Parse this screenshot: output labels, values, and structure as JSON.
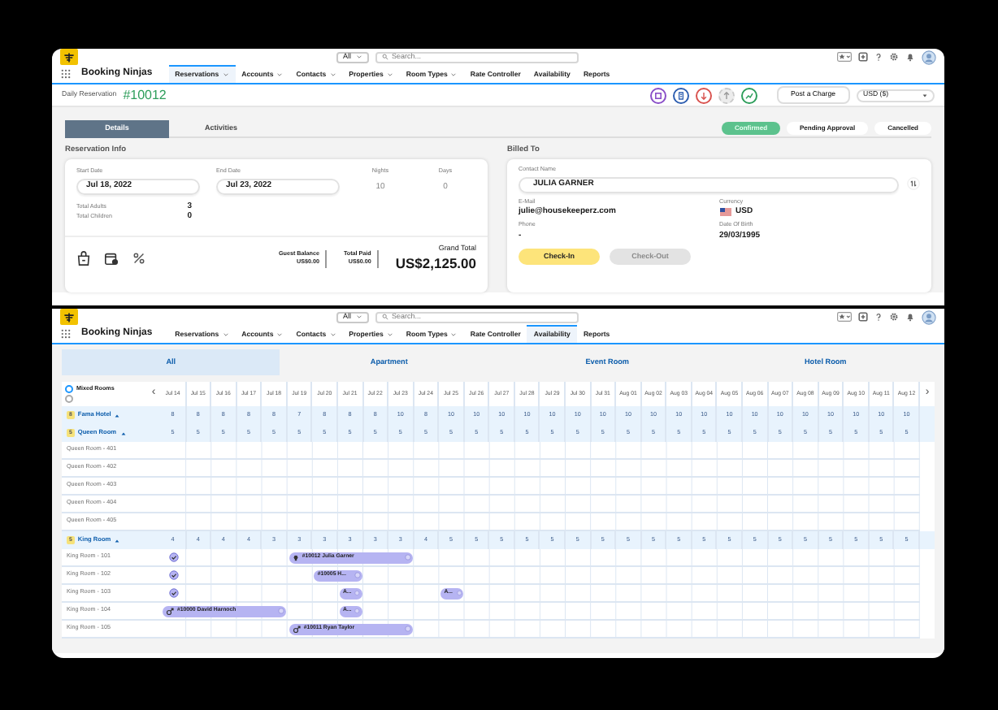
{
  "reservation_window": {
    "header": {
      "search_scope": "All",
      "search_placeholder": "Search..."
    },
    "app_name": "Booking Ninjas",
    "nav": [
      {
        "label": "Reservations",
        "has_menu": true,
        "selected": true
      },
      {
        "label": "Accounts",
        "has_menu": true,
        "selected": false
      },
      {
        "label": "Contacts",
        "has_menu": true,
        "selected": false
      },
      {
        "label": "Properties",
        "has_menu": true,
        "selected": false
      },
      {
        "label": "Room Types",
        "has_menu": true,
        "selected": false
      },
      {
        "label": "Rate Controller",
        "has_menu": false,
        "selected": false
      },
      {
        "label": "Availability",
        "has_menu": false,
        "selected": false
      },
      {
        "label": "Reports",
        "has_menu": false,
        "selected": false
      }
    ],
    "record": {
      "type_label": "Daily Reservation",
      "number": "#10012"
    },
    "action_buttons": [
      {
        "kind": "scan",
        "color": "#8a4fc8",
        "disabled": false
      },
      {
        "kind": "document",
        "color": "#2f5fb0",
        "disabled": false
      },
      {
        "kind": "download",
        "color": "#d9534f",
        "disabled": false
      },
      {
        "kind": "upload",
        "color": "#c9c9c9",
        "disabled": true
      },
      {
        "kind": "trend",
        "color": "#2e9e5b",
        "disabled": false
      }
    ],
    "post_charge": "Post a Charge",
    "currency_select": "USD ($)",
    "tabs": [
      {
        "label": "Details",
        "selected": true
      },
      {
        "label": "Activities",
        "selected": false
      }
    ],
    "statuses": [
      {
        "label": "Confirmed",
        "selected": true
      },
      {
        "label": "Pending Approval",
        "selected": false
      },
      {
        "label": "Cancelled",
        "selected": false
      }
    ],
    "reservation_info": {
      "title": "Reservation Info",
      "dates": [
        {
          "label": "Start Date",
          "value": "Jul 18, 2022"
        },
        {
          "label": "End Date",
          "value": "Jul 23, 2022"
        }
      ],
      "stays": [
        {
          "label": "Nights",
          "value": "10"
        },
        {
          "label": "Days",
          "value": "0"
        }
      ],
      "guests": [
        {
          "label": "Total Adults",
          "value": "3"
        },
        {
          "label": "Total Children",
          "value": "0"
        }
      ],
      "totals": [
        {
          "label": "Guest Balance",
          "value": "US$0.00"
        },
        {
          "label": "Total Paid",
          "value": "US$0.00"
        }
      ],
      "grand_total": {
        "label": "Grand Total",
        "value": "US$2,125.00"
      }
    },
    "billed_to": {
      "title": "Billed To",
      "contact": {
        "label": "Contact Name",
        "value": "JULIA GARNER"
      },
      "fields": [
        {
          "label": "E-Mail",
          "value": "julie@housekeeperz.com",
          "kind": "text"
        },
        {
          "label": "Currency",
          "value": "USD",
          "kind": "flag"
        },
        {
          "label": "Phone",
          "value": "-",
          "kind": "text"
        },
        {
          "label": "Date Of Birth",
          "value": "29/03/1995",
          "kind": "text"
        }
      ],
      "buttons": [
        {
          "label": "Check-In",
          "disabled": false
        },
        {
          "label": "Check-Out",
          "disabled": true
        }
      ]
    }
  },
  "availability_window": {
    "header": {
      "search_scope": "All",
      "search_placeholder": "Search..."
    },
    "app_name": "Booking Ninjas",
    "nav": [
      {
        "label": "Reservations",
        "has_menu": true,
        "selected": false
      },
      {
        "label": "Accounts",
        "has_menu": true,
        "selected": false
      },
      {
        "label": "Contacts",
        "has_menu": true,
        "selected": false
      },
      {
        "label": "Properties",
        "has_menu": true,
        "selected": false
      },
      {
        "label": "Room Types",
        "has_menu": true,
        "selected": false
      },
      {
        "label": "Rate Controller",
        "has_menu": false,
        "selected": false
      },
      {
        "label": "Availability",
        "has_menu": false,
        "selected": true
      },
      {
        "label": "Reports",
        "has_menu": false,
        "selected": false
      }
    ],
    "categories": [
      {
        "label": "All",
        "selected": true
      },
      {
        "label": "Apartment",
        "selected": false
      },
      {
        "label": "Event Room",
        "selected": false
      },
      {
        "label": "Hotel Room",
        "selected": false
      }
    ],
    "view_options": [
      {
        "label": "Mixed Rooms",
        "selected": true
      },
      {
        "selected": false
      }
    ],
    "prev": "‹",
    "next": "›",
    "dates": [
      "Jul 14",
      "Jul 15",
      "Jul 16",
      "Jul 17",
      "Jul 18",
      "Jul 19",
      "Jul 20",
      "Jul 21",
      "Jul 22",
      "Jul 23",
      "Jul 24",
      "Jul 25",
      "Jul 26",
      "Jul 27",
      "Jul 28",
      "Jul 29",
      "Jul 30",
      "Jul 31",
      "Aug 01",
      "Aug 02",
      "Aug 03",
      "Aug 04",
      "Aug 05",
      "Aug 06",
      "Aug 07",
      "Aug 08",
      "Aug 09",
      "Aug 10",
      "Aug 11",
      "Aug 12"
    ],
    "rows": [
      {
        "kind": "group",
        "badge": "8",
        "label": "Fama Hotel",
        "expanded": true,
        "counts": [
          "8",
          "8",
          "8",
          "8",
          "8",
          "7",
          "8",
          "8",
          "8",
          "10",
          "8",
          "10",
          "10",
          "10",
          "10",
          "10",
          "10",
          "10",
          "10",
          "10",
          "10",
          "10",
          "10",
          "10",
          "10",
          "10",
          "10",
          "10",
          "10",
          "10"
        ]
      },
      {
        "kind": "group",
        "badge": "5",
        "label": "Queen Room",
        "expanded": true,
        "counts": [
          "5",
          "5",
          "5",
          "5",
          "5",
          "5",
          "5",
          "5",
          "5",
          "5",
          "5",
          "5",
          "5",
          "5",
          "5",
          "5",
          "5",
          "5",
          "5",
          "5",
          "5",
          "5",
          "5",
          "5",
          "5",
          "5",
          "5",
          "5",
          "5",
          "5"
        ]
      },
      {
        "kind": "room",
        "label": "Queen Room - 401",
        "checked_in": false,
        "bookings": []
      },
      {
        "kind": "room",
        "label": "Queen Room - 402",
        "checked_in": false,
        "bookings": []
      },
      {
        "kind": "room",
        "label": "Queen Room - 403",
        "checked_in": false,
        "bookings": []
      },
      {
        "kind": "room",
        "label": "Queen Room - 404",
        "checked_in": false,
        "bookings": []
      },
      {
        "kind": "room",
        "label": "Queen Room - 405",
        "checked_in": false,
        "bookings": []
      },
      {
        "kind": "group",
        "badge": "5",
        "label": "King Room",
        "expanded": true,
        "counts": [
          "4",
          "4",
          "4",
          "4",
          "3",
          "3",
          "3",
          "3",
          "3",
          "3",
          "4",
          "5",
          "5",
          "5",
          "5",
          "5",
          "5",
          "5",
          "5",
          "5",
          "5",
          "5",
          "5",
          "5",
          "5",
          "5",
          "5",
          "5",
          "5",
          "5"
        ]
      },
      {
        "kind": "room",
        "label": "King Room - 101",
        "checked_in": true,
        "bookings": [
          {
            "label": "#10012  Julia Garner",
            "kind": "pin"
          }
        ]
      },
      {
        "kind": "room",
        "label": "King Room - 102",
        "checked_in": true,
        "bookings": [
          {
            "label": "#10005  H...",
            "kind": "plain"
          }
        ]
      },
      {
        "kind": "room",
        "label": "King Room - 103",
        "checked_in": true,
        "bookings": [
          {
            "label": "A...",
            "kind": "plain"
          },
          {
            "label": "A...",
            "kind": "plain"
          }
        ]
      },
      {
        "kind": "room",
        "label": "King Room - 104",
        "checked_in": false,
        "bookings": [
          {
            "label": "#10000  David Harnoch",
            "kind": "male"
          },
          {
            "label": "A...",
            "kind": "plain"
          }
        ]
      },
      {
        "kind": "room",
        "label": "King Room - 105",
        "checked_in": false,
        "bookings": [
          {
            "label": "#10011  Ryan Taylor",
            "kind": "male"
          }
        ]
      }
    ]
  }
}
